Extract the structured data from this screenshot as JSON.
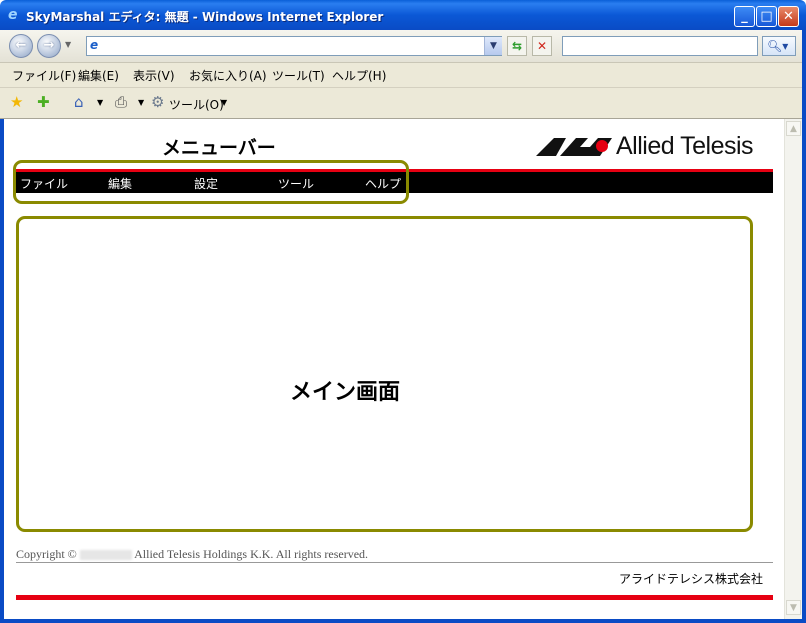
{
  "window": {
    "title": "SkyMarshal エディタ: 無題 - Windows Internet Explorer"
  },
  "browser": {
    "menu": [
      {
        "label": "ファイル(F)"
      },
      {
        "label": "編集(E)"
      },
      {
        "label": "表示(V)"
      },
      {
        "label": "お気に入り(A)"
      },
      {
        "label": "ツール(T)"
      },
      {
        "label": "ヘルプ(H)"
      }
    ],
    "tools_label": "ツール(O)",
    "address_value": "",
    "search_value": ""
  },
  "page": {
    "menubar_title": "メニューバー",
    "logo_text": "Allied Telesis",
    "nav": [
      {
        "label": "ファイル"
      },
      {
        "label": "編集"
      },
      {
        "label": "設定"
      },
      {
        "label": "ツール"
      },
      {
        "label": "ヘルプ"
      }
    ],
    "main_label": "メイン画面",
    "copyright_prefix": "Copyright ©",
    "copyright_suffix": "Allied Telesis Holdings K.K. All rights reserved.",
    "company": "アライドテレシス株式会社"
  },
  "colors": {
    "accent_red": "#e60012",
    "highlight_olive": "#8a8a00",
    "titlebar_blue": "#0a5fd8"
  }
}
